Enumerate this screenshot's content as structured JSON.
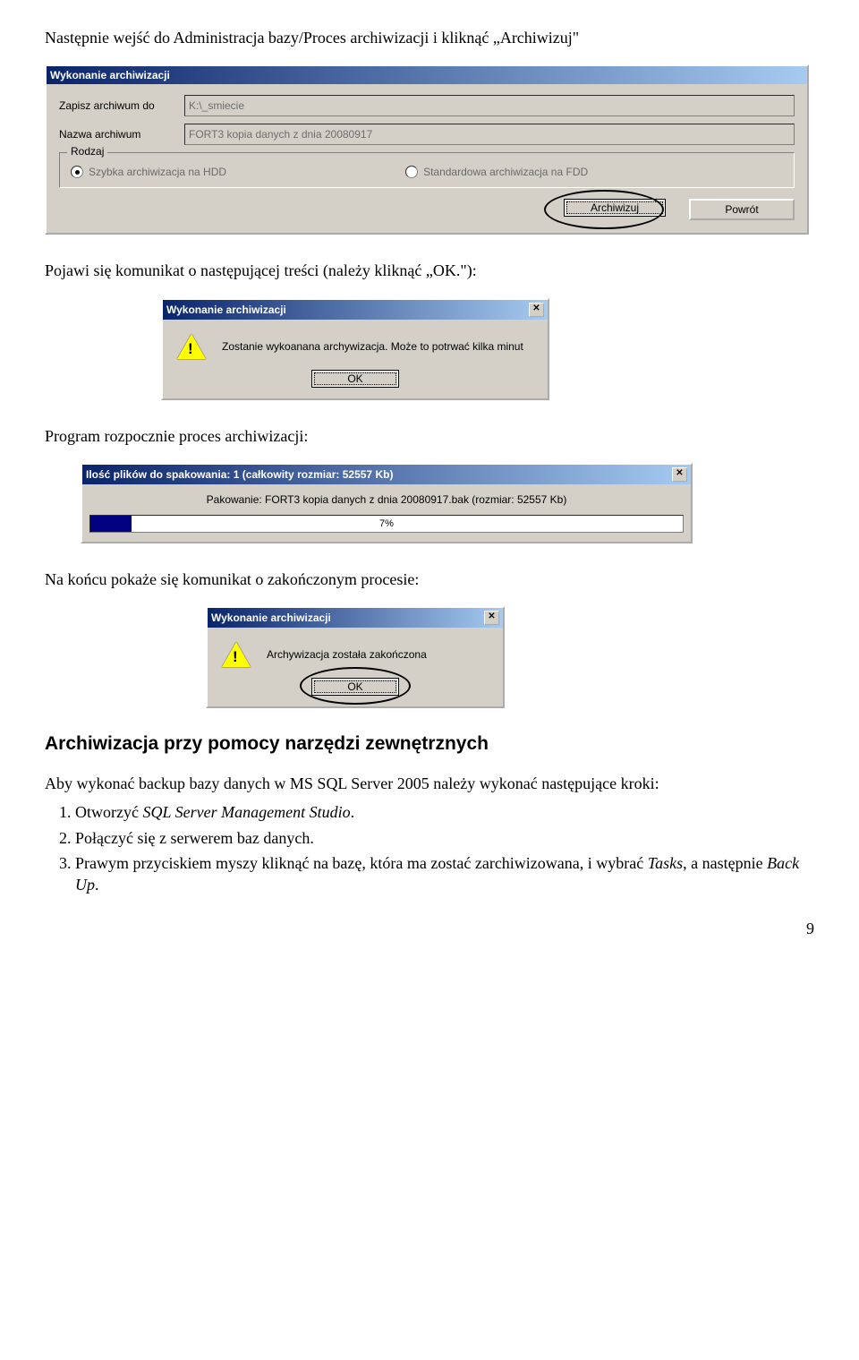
{
  "text": {
    "intro1": "Następnie wejść do Administracja bazy/Proces archiwizacji i kliknąć „Archiwizuj\"",
    "intro2": "Pojawi się komunikat o następującej treści (należy kliknąć „OK.\"):",
    "intro3": "Program rozpocznie proces archiwizacji:",
    "intro4": "Na końcu pokaże się komunikat o zakończonym procesie:",
    "section_heading": "Archiwizacja przy pomocy narzędzi zewnętrznych",
    "intro5": "Aby wykonać backup bazy danych w MS SQL Server 2005 należy wykonać następujące kroki:",
    "page_num": "9"
  },
  "dialog1": {
    "title": "Wykonanie archiwizacji",
    "label_path": "Zapisz archiwum do",
    "value_path": "K:\\_smiecie",
    "label_name": "Nazwa archiwum",
    "value_name": "FORT3 kopia danych z dnia 20080917",
    "group_label": "Rodzaj",
    "radio1": "Szybka archiwizacja na HDD",
    "radio2": "Standardowa archiwizacja na FDD",
    "btn_archive": "Archiwizuj",
    "btn_back": "Powrót"
  },
  "msgbox1": {
    "title": "Wykonanie archiwizacji",
    "text": "Zostanie wykoanana archywizacja. Może to potrwać kilka minut",
    "ok": "OK"
  },
  "progress": {
    "title": "Ilość plików do spakowania: 1 (całkowity rozmiar: 52557 Kb)",
    "text": "Pakowanie: FORT3 kopia danych z dnia 20080917.bak (rozmiar: 52557 Kb)",
    "pct_label": "7%",
    "pct_value": 7
  },
  "msgbox2": {
    "title": "Wykonanie archiwizacji",
    "text": "Archywizacja została zakończona",
    "ok": "OK"
  },
  "list": {
    "i1a": "Otworzyć ",
    "i1b": "SQL Server Management Studio",
    "i1c": ".",
    "i2": "Połączyć się z serwerem baz danych.",
    "i3a": "Prawym przyciskiem myszy kliknąć na bazę, która ma zostać zarchiwizowana, i wybrać ",
    "i3b": "Tasks",
    "i3c": ", a następnie ",
    "i3d": "Back Up",
    "i3e": "."
  }
}
